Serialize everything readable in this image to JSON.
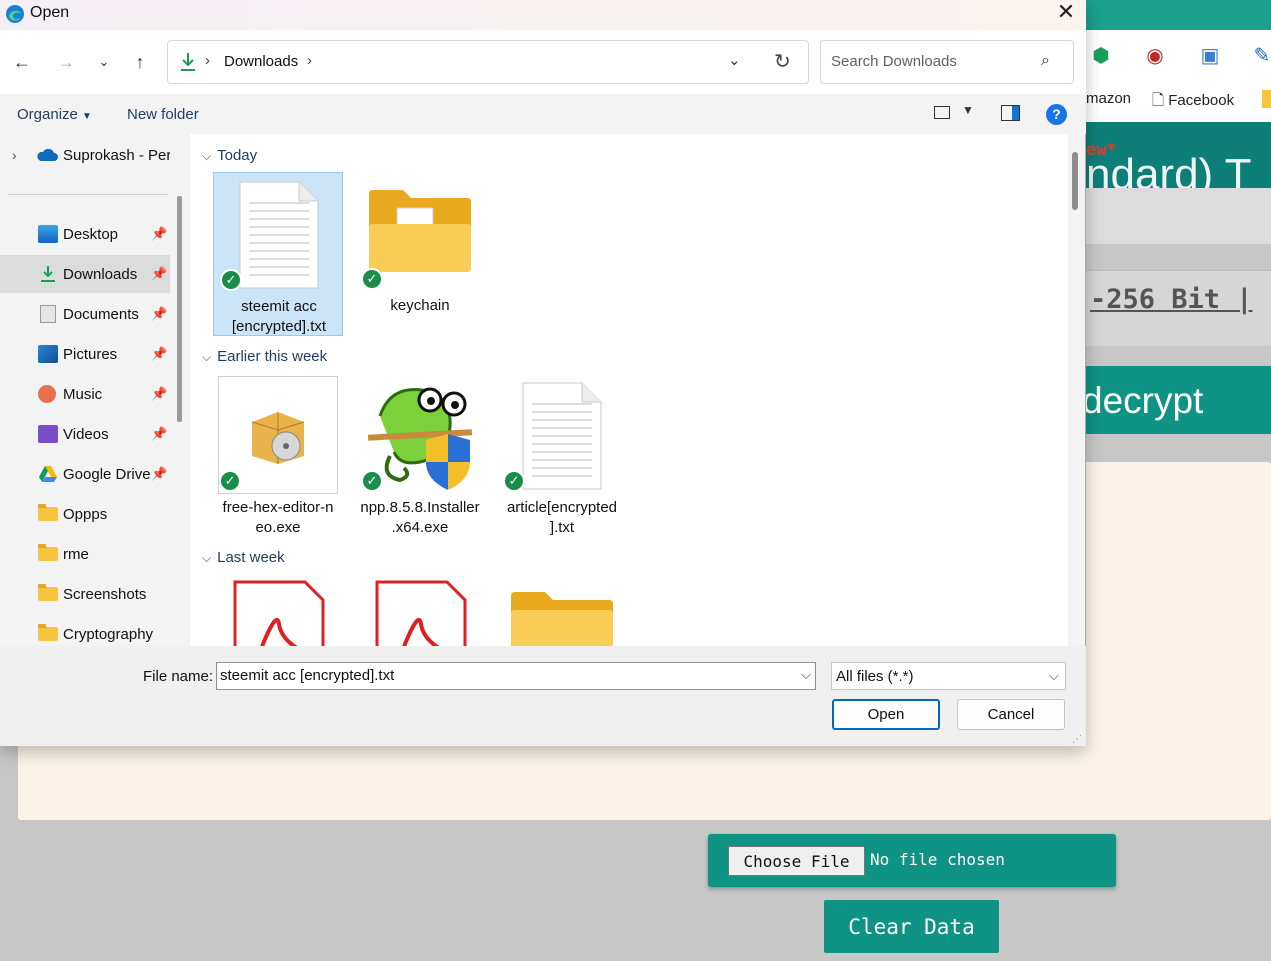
{
  "background_page": {
    "bookmarks": [
      "mazon",
      "Facebook"
    ],
    "partial_red_text": "ew*",
    "partial_heading": "ndard) T",
    "partial_mono": "-256 Bit |",
    "decrypt_label": "decrypt",
    "file_input": {
      "button_label": "Choose File",
      "status": "No file chosen"
    },
    "clear_button": "Clear Data",
    "colors": {
      "teal": "#0f9384",
      "paper": "#fbf4e6"
    }
  },
  "dialog": {
    "title": "Open",
    "address": {
      "folder": "Downloads"
    },
    "search": {
      "placeholder": "Search Downloads"
    },
    "commands": {
      "organize": "Organize",
      "new_folder": "New folder"
    },
    "sidebar": {
      "onedrive": "Suprokash - Pers",
      "items": [
        {
          "label": "Desktop",
          "icon": "desktop-icon",
          "pinned": true
        },
        {
          "label": "Downloads",
          "icon": "download-icon",
          "pinned": true,
          "active": true
        },
        {
          "label": "Documents",
          "icon": "document-icon",
          "pinned": true
        },
        {
          "label": "Pictures",
          "icon": "picture-icon",
          "pinned": true
        },
        {
          "label": "Music",
          "icon": "music-icon",
          "pinned": true
        },
        {
          "label": "Videos",
          "icon": "video-icon",
          "pinned": true
        },
        {
          "label": "Google Drive",
          "icon": "google-drive-icon",
          "pinned": true
        },
        {
          "label": "Oppps",
          "icon": "folder-icon",
          "pinned": false
        },
        {
          "label": "rme",
          "icon": "folder-icon",
          "pinned": false
        },
        {
          "label": "Screenshots",
          "icon": "folder-icon",
          "pinned": false
        },
        {
          "label": "Cryptography",
          "icon": "folder-icon",
          "pinned": false
        }
      ]
    },
    "groups": [
      {
        "heading": "Today",
        "files": [
          {
            "line1": "steemit acc",
            "line2": "[encrypted].txt",
            "icon": "text-file-icon",
            "selected": true
          },
          {
            "line1": "keychain",
            "line2": "",
            "icon": "folder-icon"
          }
        ]
      },
      {
        "heading": "Earlier this week",
        "files": [
          {
            "line1": "free-hex-editor-n",
            "line2": "eo.exe",
            "icon": "installer-icon"
          },
          {
            "line1": "npp.8.5.8.Installer",
            "line2": ".x64.exe",
            "icon": "notepad-plus-plus-icon"
          },
          {
            "line1": "article[encrypted",
            "line2": "].txt",
            "icon": "text-file-icon"
          }
        ]
      },
      {
        "heading": "Last week",
        "files": [
          {
            "icon": "pdf-icon"
          },
          {
            "icon": "pdf-icon"
          },
          {
            "icon": "zip-folder-icon"
          }
        ]
      }
    ],
    "file_name_label": "File name:",
    "file_name_value": "steemit acc [encrypted].txt",
    "file_type": "All files (*.*)",
    "open_button": "Open",
    "cancel_button": "Cancel"
  }
}
